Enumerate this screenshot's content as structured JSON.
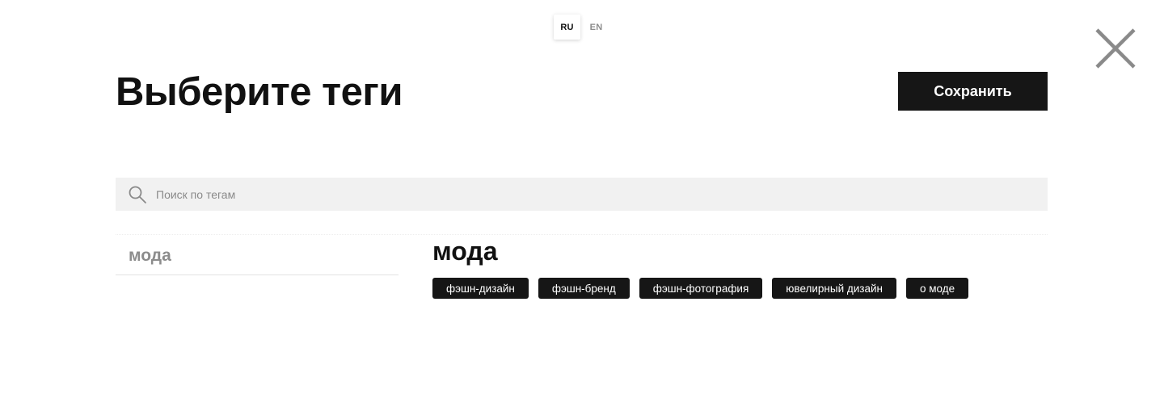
{
  "lang": {
    "options": [
      {
        "label": "RU",
        "active": true
      },
      {
        "label": "EN",
        "active": false
      }
    ]
  },
  "header": {
    "title": "Выберите теги",
    "save_label": "Сохранить",
    "close_icon": "close-icon"
  },
  "search": {
    "placeholder": "Поиск по тегам",
    "value": "",
    "icon": "search-icon"
  },
  "categories": [
    {
      "label": "мода"
    }
  ],
  "tag_group": {
    "title": "мода",
    "tags": [
      {
        "label": "фэшн-дизайн"
      },
      {
        "label": "фэшн-бренд"
      },
      {
        "label": "фэшн-фотография"
      },
      {
        "label": "ювелирный дизайн"
      },
      {
        "label": "о моде"
      }
    ]
  },
  "colors": {
    "primary_button": "#161616",
    "search_bg": "#f1f1f1",
    "muted_text": "#8c8c8c"
  }
}
